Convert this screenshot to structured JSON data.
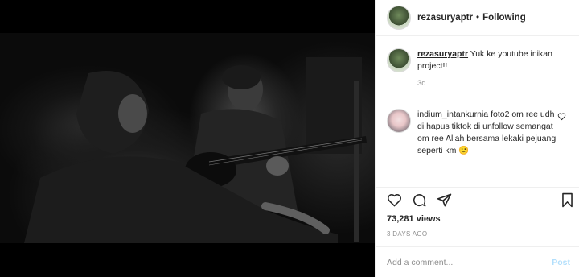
{
  "post": {
    "username": "rezasuryaptr",
    "separator": "•",
    "follow_status": "Following"
  },
  "caption": {
    "username": "rezasuryaptr",
    "text": "Yuk ke youtube inikan project!!",
    "time": "3d"
  },
  "comments": [
    {
      "username": "indium_intankurnia",
      "text": "foto2 om ree udh di hapus tiktok di unfollow semangat om ree Allah bersama lekaki pejuang seperti km 🙂"
    }
  ],
  "engagement": {
    "views": "73,281 views",
    "date": "3 DAYS AGO"
  },
  "add_comment": {
    "placeholder": "Add a comment...",
    "post_label": "Post"
  },
  "icons": {
    "like": "heart-icon",
    "comment": "comment-icon",
    "share": "share-icon",
    "save": "bookmark-icon",
    "mute": "speaker-muted-icon"
  },
  "colors": {
    "post_button": "#b2dffc",
    "secondary_text": "#8e8e8e"
  }
}
